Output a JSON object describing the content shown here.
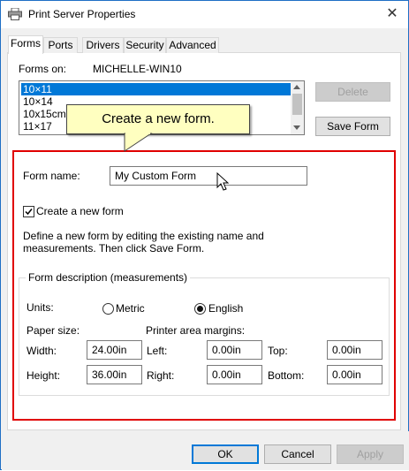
{
  "window": {
    "title": "Print Server Properties",
    "close_glyph": "✕"
  },
  "tabs": [
    {
      "label": "Forms"
    },
    {
      "label": "Ports"
    },
    {
      "label": "Drivers"
    },
    {
      "label": "Security"
    },
    {
      "label": "Advanced"
    }
  ],
  "forms": {
    "forms_on_label": "Forms on:",
    "server_name": "MICHELLE-WIN10",
    "list": [
      "10×11",
      "10×14",
      "10x15cm",
      "11×17"
    ],
    "selected_index": 0,
    "delete_label": "Delete",
    "save_form_label": "Save Form"
  },
  "callout": {
    "text": "Create a new form."
  },
  "form": {
    "name_label": "Form name:",
    "name_value": "My Custom Form",
    "create_new_label": "Create a new form",
    "create_new_checked": true,
    "instructions_line1": "Define a new form by editing the existing name and",
    "instructions_line2": "measurements. Then click Save Form."
  },
  "description": {
    "title": "Form description (measurements)",
    "units_label": "Units:",
    "metric_label": "Metric",
    "english_label": "English",
    "selected_unit": "English",
    "paper_size_label": "Paper size:",
    "printer_margins_label": "Printer area margins:",
    "width_label": "Width:",
    "width_value": "24.00in",
    "height_label": "Height:",
    "height_value": "36.00in",
    "left_label": "Left:",
    "left_value": "0.00in",
    "right_label": "Right:",
    "right_value": "0.00in",
    "top_label": "Top:",
    "top_value": "0.00in",
    "bottom_label": "Bottom:",
    "bottom_value": "0.00in"
  },
  "footer": {
    "ok_label": "OK",
    "cancel_label": "Cancel",
    "apply_label": "Apply"
  },
  "colors": {
    "selection": "#0078d7",
    "highlight_box": "#e00000",
    "callout_bg": "#ffffc0"
  }
}
